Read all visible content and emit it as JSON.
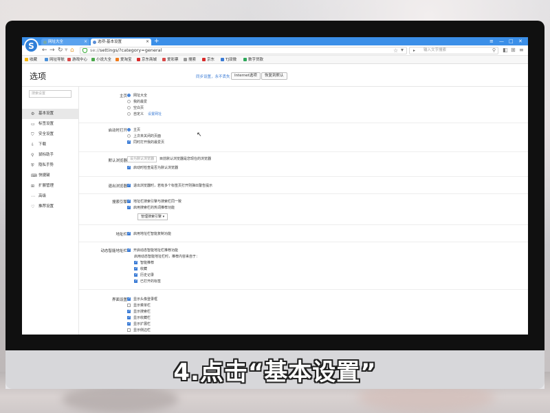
{
  "caption": "4.点击“基本设置”",
  "browser": {
    "tabs": [
      {
        "label": "网址大全",
        "active": false
      },
      {
        "label": "选项-基本设置",
        "active": true
      }
    ],
    "new_tab": "+",
    "window_controls": [
      "≡",
      "—",
      "□",
      "✕"
    ],
    "address": {
      "prefix": "se://",
      "path": "settings/?category=general"
    },
    "search_placeholder": "输入文字搜索",
    "bookmarks": [
      "收藏",
      "网址导航",
      "游戏中心",
      "小说大全",
      "爱淘宝",
      "京东商城",
      "爱彩票",
      "搜索",
      "京东",
      "TJ双微",
      "数字贷款"
    ]
  },
  "header": {
    "title": "选项",
    "sync_link": "同步设置，永不丢失",
    "internet_options": "Internet选项",
    "restore_default": "恢复到默认"
  },
  "sidebar": {
    "search_placeholder": "搜索设置",
    "items": [
      {
        "label": "基本设置",
        "icon": "gear-icon",
        "glyph": "⚙",
        "active": true
      },
      {
        "label": "标签设置",
        "icon": "tab-icon",
        "glyph": "▭",
        "active": false
      },
      {
        "label": "安全设置",
        "icon": "shield-icon",
        "glyph": "⛉",
        "active": false
      },
      {
        "label": "下载",
        "icon": "download-icon",
        "glyph": "⇩",
        "active": false
      },
      {
        "label": "鼠标助手",
        "icon": "mouse-icon",
        "glyph": "⚲",
        "active": false
      },
      {
        "label": "隐私手势",
        "icon": "lock-icon",
        "glyph": "⛨",
        "active": false
      },
      {
        "label": "快捷键",
        "icon": "keyboard-icon",
        "glyph": "⌨",
        "active": false
      },
      {
        "label": "扩展管理",
        "icon": "puzzle-icon",
        "glyph": "⊞",
        "active": false
      },
      {
        "label": "高级",
        "icon": "more-icon",
        "glyph": "⋯",
        "active": false
      },
      {
        "label": "推荐设置",
        "icon": "heart-icon",
        "glyph": "♡",
        "active": false
      }
    ]
  },
  "sections": {
    "homepage": {
      "label": "主页",
      "options": [
        {
          "label": "网址大全",
          "checked": true
        },
        {
          "label": "我的最爱",
          "checked": false
        },
        {
          "label": "空白页",
          "checked": false
        },
        {
          "label": "自定义",
          "checked": false
        }
      ],
      "set_url_link": "设置网址"
    },
    "startup": {
      "label": "启动时打开",
      "options": [
        {
          "label": "主页",
          "checked": true
        },
        {
          "label": "上次未关闭的页面",
          "checked": false
        }
      ],
      "checkbox": {
        "label": "同时打开我的最爱页",
        "checked": true
      }
    },
    "default_browser": {
      "label": "默认浏览器",
      "button": "设为默认浏览器",
      "note": "目前默认浏览器是您现在的浏览器",
      "checkbox": {
        "label": "启动时检查是否为默认浏览器",
        "checked": true
      }
    },
    "close_browser": {
      "label": "退出浏览器",
      "checkbox": {
        "label": "退出浏览器时，若有多个标签页打开则弹出警告提示",
        "checked": true
      }
    },
    "search_engine": {
      "label": "搜索引擎",
      "checkboxes": [
        {
          "label": "地址栏搜索引擎与搜索栏同一致",
          "checked": true
        },
        {
          "label": "启用搜索栏的热词推荐功能",
          "checked": true
        }
      ],
      "manage_button": "管理搜索引擎"
    },
    "address_bar": {
      "label": "地址栏",
      "checkbox": {
        "label": "启用地址栏智能复制功能",
        "checked": true
      }
    },
    "smart_address_bar": {
      "label": "动态智能地址栏",
      "main": {
        "label": "开启动态智能地址栏推荐功能",
        "checked": true
      },
      "note": "启用动态智能地址栏时，推荐内容来自于：",
      "sub": [
        {
          "label": "智能推荐",
          "checked": true
        },
        {
          "label": "收藏",
          "checked": true
        },
        {
          "label": "历史记录",
          "checked": true
        },
        {
          "label": "已打开的标签",
          "checked": true
        }
      ]
    },
    "appearance": {
      "label": "界面设置",
      "checkboxes": [
        {
          "label": "显示头像登录框",
          "checked": true
        },
        {
          "label": "显示菜单栏",
          "checked": false
        },
        {
          "label": "显示搜索栏",
          "checked": true
        },
        {
          "label": "显示收藏栏",
          "checked": true
        },
        {
          "label": "显示扩展栏",
          "checked": true
        },
        {
          "label": "显示侧边栏",
          "checked": false
        }
      ]
    }
  }
}
